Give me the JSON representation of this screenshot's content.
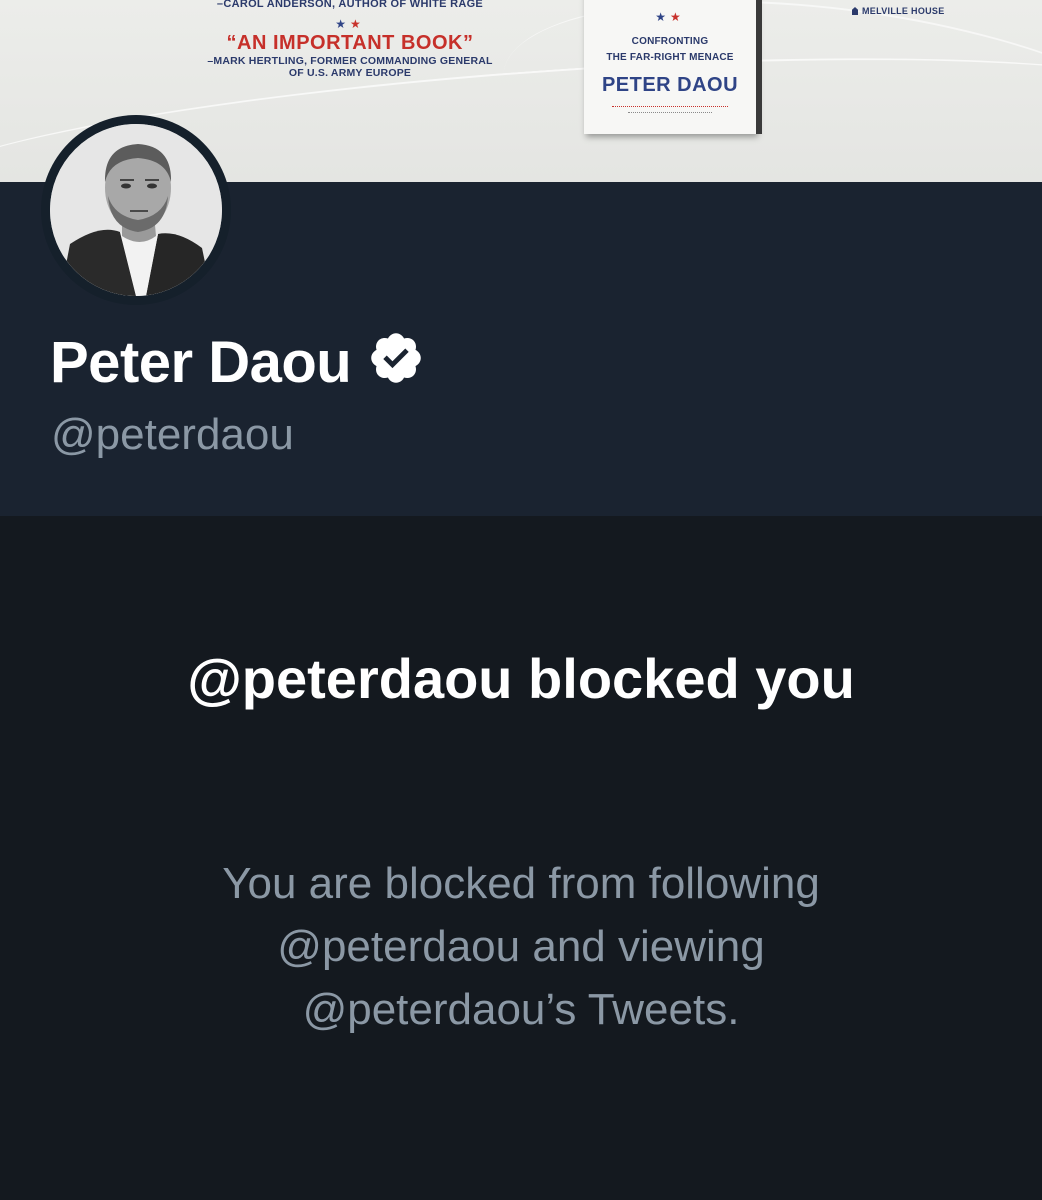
{
  "banner": {
    "quote_author": "–CAROL ANDERSON, AUTHOR OF WHITE RAGE",
    "quote_title": "“AN IMPORTANT BOOK”",
    "quote_by_line1": "–MARK HERTLING, FORMER COMMANDING GENERAL",
    "quote_by_line2": "OF U.S. ARMY EUROPE",
    "book_subtitle_line1": "CONFRONTING",
    "book_subtitle_line2": "THE FAR-RIGHT MENACE",
    "book_author": "PETER DAOU",
    "publisher": "MELVILLE HOUSE",
    "colors": {
      "navy": "#2b3a6b",
      "red": "#c6302a"
    }
  },
  "profile": {
    "display_name": "Peter Daou",
    "handle": "@peterdaou",
    "verified_icon": "verified-badge-icon",
    "colors": {
      "background": "#1a2330",
      "name": "#ffffff",
      "handle": "#8b98a5"
    }
  },
  "blocked": {
    "title": "@peterdaou blocked you",
    "description": "You are blocked from following @peterdaou and viewing @peterdaou’s Tweets.",
    "colors": {
      "background": "#14191f",
      "title": "#ffffff",
      "description": "#8b98a5"
    }
  }
}
